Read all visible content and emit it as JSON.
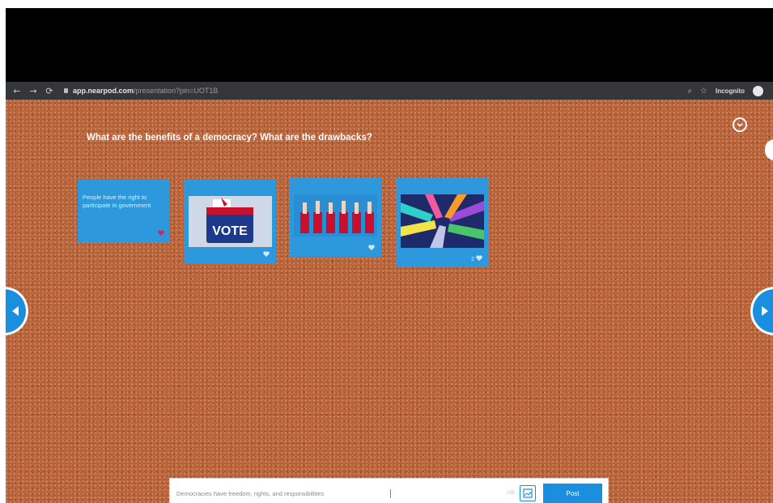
{
  "browser": {
    "url_host": "app.nearpod.com",
    "url_path": "/presentation?pin=UOT1B",
    "profile_label": "Incognito",
    "icons": [
      "back-icon",
      "forward-icon",
      "reload-icon",
      "lock-icon",
      "zoom-icon",
      "star-icon",
      "avatar"
    ]
  },
  "board": {
    "question": "What are the benefits of a democracy? What are the drawbacks?",
    "posts": [
      {
        "type": "text",
        "text": "People have the right to participate in government",
        "liked": true,
        "like_color": "#d4236a"
      },
      {
        "type": "image",
        "image": "vote-ballot-box",
        "image_label": "VOTE"
      },
      {
        "type": "image",
        "image": "raised-hands-protest"
      },
      {
        "type": "image",
        "image": "colorful-hands-together",
        "count": "2"
      }
    ]
  },
  "compose": {
    "value": "Democracies have freedom, rights, and responsibilities",
    "char_count": "195",
    "post_label": "Post",
    "icons": [
      "image-upload-icon"
    ]
  },
  "colors": {
    "accent": "#1a8fe0",
    "card": "#2d99dc",
    "board": "#b8623a",
    "browser_bar": "#35363a"
  }
}
